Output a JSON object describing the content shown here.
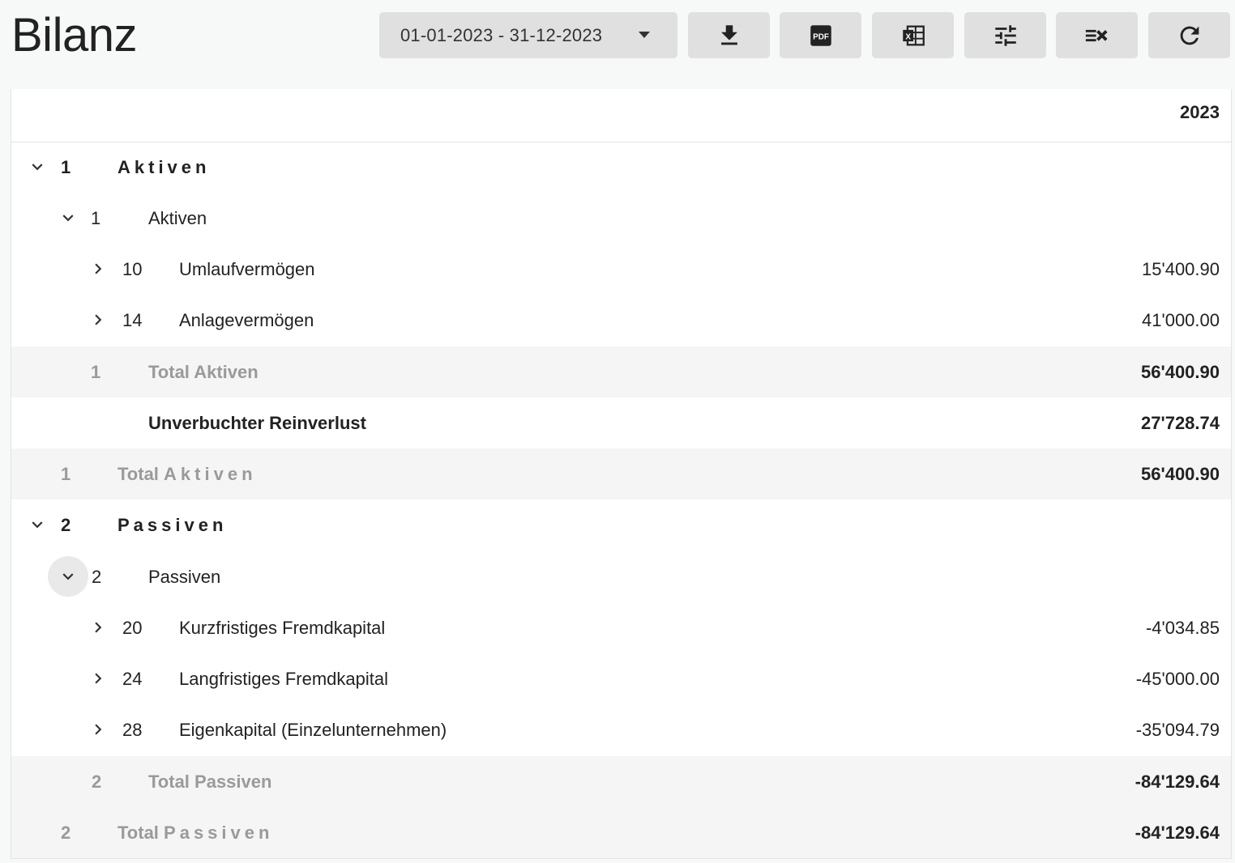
{
  "page": {
    "title": "Bilanz"
  },
  "toolbar": {
    "date_range": "01-01-2023 - 31-12-2023",
    "buttons": [
      {
        "name": "download-icon"
      },
      {
        "name": "pdf-icon",
        "text": "PDF"
      },
      {
        "name": "excel-icon",
        "text": "X"
      },
      {
        "name": "filter-settings-icon"
      },
      {
        "name": "clear-selection-icon"
      },
      {
        "name": "refresh-icon"
      }
    ]
  },
  "table": {
    "column_header": "2023",
    "rows": [
      {
        "num": "1",
        "label": "Aktiven",
        "value": ""
      },
      {
        "num": "1",
        "label": "Aktiven",
        "value": ""
      },
      {
        "num": "10",
        "label": "Umlaufvermögen",
        "value": "15'400.90"
      },
      {
        "num": "14",
        "label": "Anlagevermögen",
        "value": "41'000.00"
      },
      {
        "num": "1",
        "label": "Total Aktiven",
        "value": "56'400.90"
      },
      {
        "num": "",
        "label": "Unverbuchter Reinverlust",
        "value": "27'728.74"
      },
      {
        "num": "1",
        "label_prefix": "Total ",
        "label": "Aktiven",
        "value": "56'400.90"
      },
      {
        "num": "2",
        "label": "Passiven",
        "value": ""
      },
      {
        "num": "2",
        "label": "Passiven",
        "value": ""
      },
      {
        "num": "20",
        "label": "Kurzfristiges Fremdkapital",
        "value": "-4'034.85"
      },
      {
        "num": "24",
        "label": "Langfristiges Fremdkapital",
        "value": "-45'000.00"
      },
      {
        "num": "28",
        "label": "Eigenkapital (Einzelunternehmen)",
        "value": "-35'094.79"
      },
      {
        "num": "2",
        "label": "Total Passiven",
        "value": "-84'129.64"
      },
      {
        "num": "2",
        "label_prefix": "Total ",
        "label": "Passiven",
        "value": "-84'129.64"
      }
    ]
  }
}
